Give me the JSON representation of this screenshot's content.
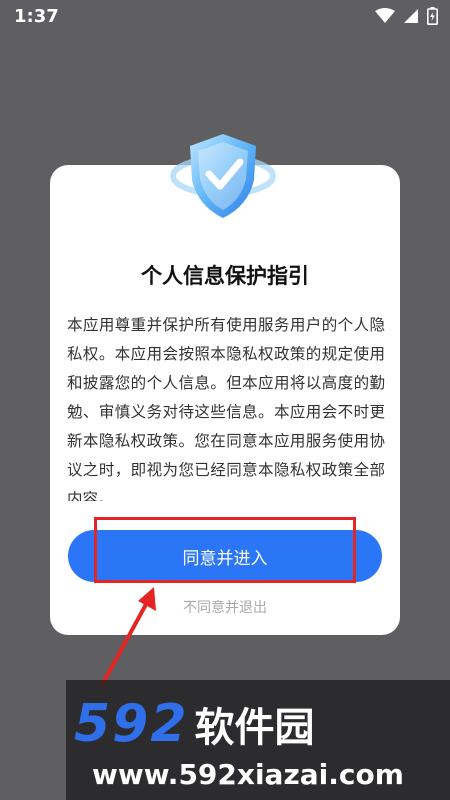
{
  "status_bar": {
    "time": "1:37",
    "icons": [
      "wifi-icon",
      "cellular-signal-icon",
      "battery-icon"
    ]
  },
  "dialog": {
    "title": "个人信息保护指引",
    "body": "本应用尊重并保护所有使用服务用户的个人隐私权。本应用会按照本隐私权政策的规定使用和披露您的个人信息。但本应用将以高度的勤勉、审慎义务对待这些信息。本应用会不时更新本隐私权政策。您在同意本应用服务使用协议之时，即视为您已经同意本隐私权政策全部内容。",
    "agree_button": "同意并进入",
    "disagree_link": "不同意并退出"
  },
  "watermark": {
    "logo_number": "592",
    "logo_text": "软件园",
    "url": "www.592xiazai.com"
  },
  "colors": {
    "accent": "#2a76f6",
    "annotation": "#e52424",
    "overlay": "#5f5f61"
  }
}
